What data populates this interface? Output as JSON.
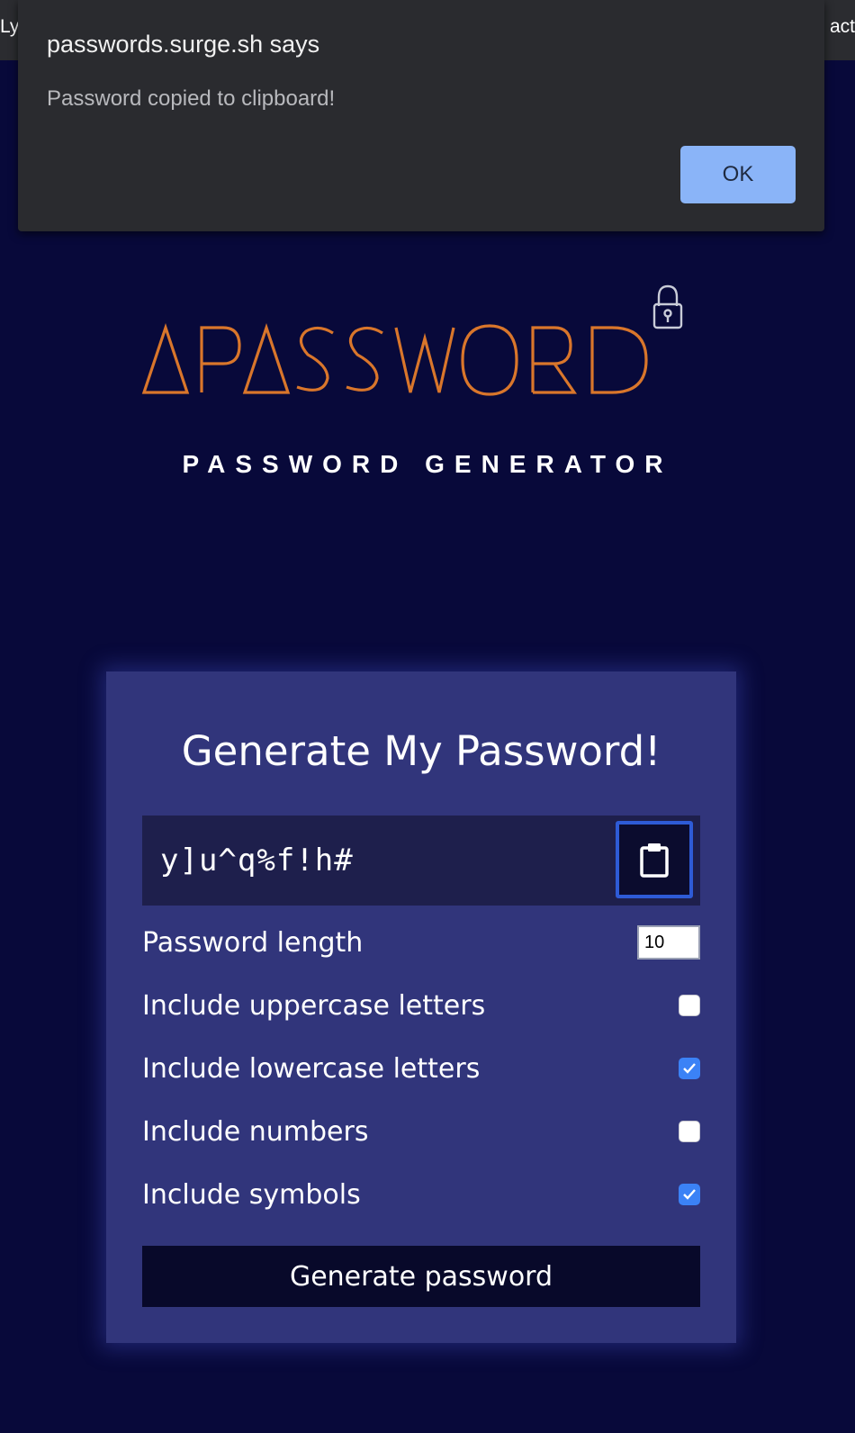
{
  "browser": {
    "left_fragment": "Ly",
    "right_fragment": "act"
  },
  "dialog": {
    "title": "passwords.surge.sh says",
    "message": "Password copied to clipboard!",
    "ok_label": "OK"
  },
  "logo": {
    "wordmark": "APASSWORD",
    "icon": "padlock-icon",
    "subtitle": "PASSWORD GENERATOR",
    "color": "#d9762b"
  },
  "card": {
    "title": "Generate My Password!",
    "password": "y]u^q%f!h#",
    "copy_icon": "clipboard-icon",
    "length_label": "Password length",
    "length_value": "10",
    "options": [
      {
        "label": "Include uppercase letters",
        "checked": false
      },
      {
        "label": "Include lowercase letters",
        "checked": true
      },
      {
        "label": "Include numbers",
        "checked": false
      },
      {
        "label": "Include symbols",
        "checked": true
      }
    ],
    "generate_label": "Generate password"
  },
  "colors": {
    "page_bg": "#08093a",
    "card_bg": "#31357b",
    "accent": "#3b82f6",
    "dialog_button": "#8ab4f8"
  }
}
